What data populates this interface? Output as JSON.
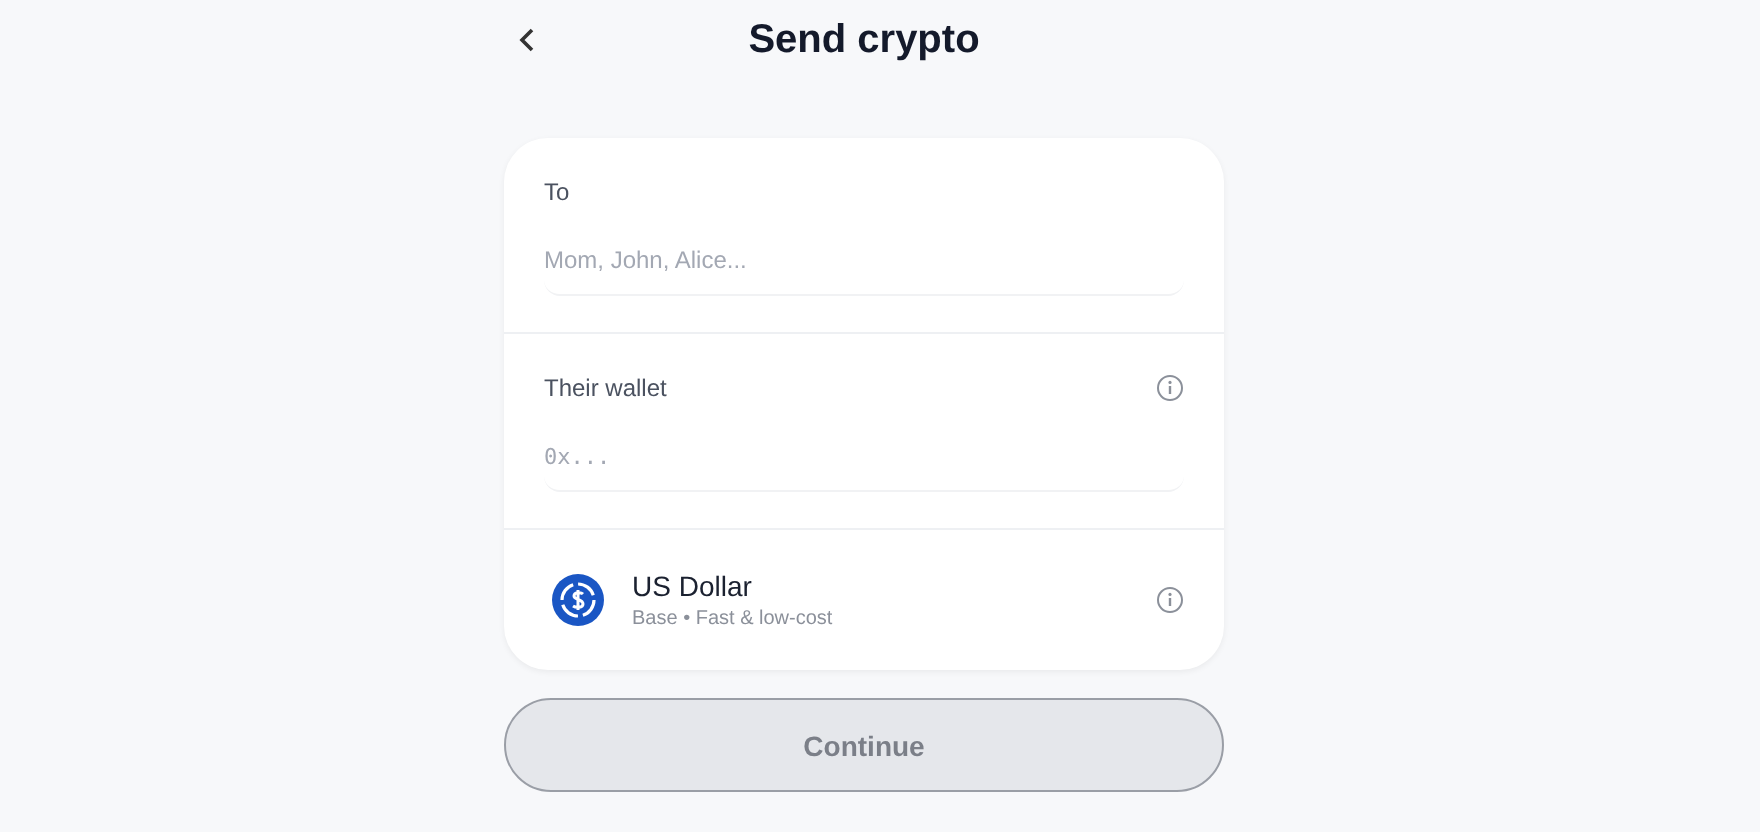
{
  "header": {
    "title": "Send crypto"
  },
  "fields": [
    {
      "label": "To",
      "placeholder": "Mom, John, Alice...",
      "info": false,
      "mono": false
    },
    {
      "label": "Their wallet",
      "placeholder": "0x...",
      "info": true,
      "mono": true
    }
  ],
  "asset": {
    "name": "US Dollar",
    "subtitle": "Base • Fast & low-cost",
    "info": true
  },
  "continue_button": {
    "label": "Continue",
    "disabled": true
  }
}
